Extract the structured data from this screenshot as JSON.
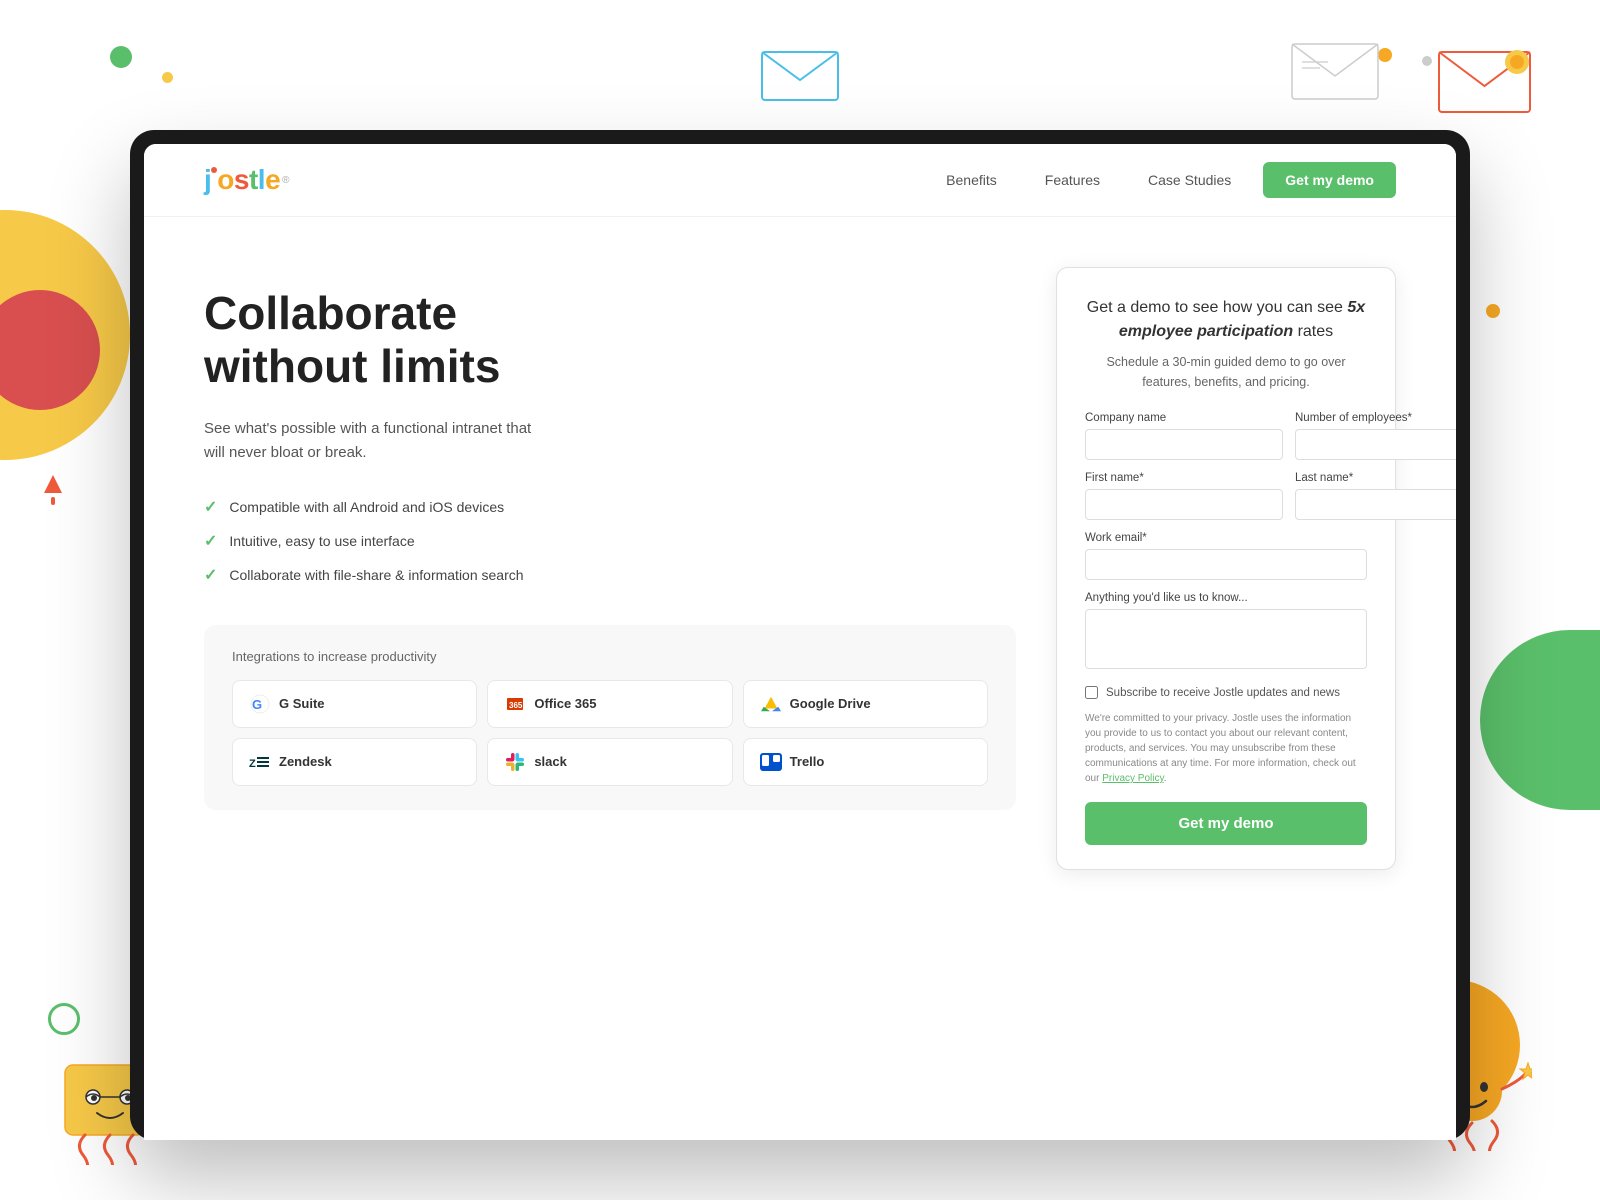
{
  "nav": {
    "logo": "jostle",
    "links": [
      "Benefits",
      "Features",
      "Case Studies"
    ],
    "cta_label": "Get my demo"
  },
  "hero": {
    "title_line1": "Collaborate",
    "title_line2": "without limits",
    "subtitle": "See what's possible with a functional intranet that will never bloat or break.",
    "features": [
      "Compatible with all Android and iOS devices",
      "Intuitive, easy to use interface",
      "Collaborate with file-share & information search"
    ]
  },
  "integrations": {
    "title": "Integrations to increase productivity",
    "items": [
      {
        "name": "G Suite",
        "icon": "G"
      },
      {
        "name": "Office 365",
        "icon": "O365"
      },
      {
        "name": "Google Drive",
        "icon": "GD"
      },
      {
        "name": "Zendesk",
        "icon": "ZD"
      },
      {
        "name": "slack",
        "icon": "SL"
      },
      {
        "name": "Trello",
        "icon": "TR"
      }
    ]
  },
  "demo_form": {
    "title_start": "Get a demo to see how you can see ",
    "title_emphasis": "5x employee participation",
    "title_end": " rates",
    "subtitle": "Schedule a 30-min guided demo to go over features, benefits, and pricing.",
    "fields": {
      "company_name": "Company name",
      "num_employees": "Number of employees*",
      "first_name": "First name*",
      "last_name": "Last name*",
      "work_email": "Work email*",
      "anything": "Anything you'd like us to know..."
    },
    "checkbox_label": "Subscribe to receive Jostle updates and news",
    "privacy_text": "We're committed to your privacy. Jostle uses the information you provide to us to contact you about our relevant content, products, and services. You may unsubscribe from these communications at any time. For more information, check out our",
    "privacy_link": "Privacy Policy",
    "submit_label": "Get my demo"
  },
  "colors": {
    "green": "#5ABF6A",
    "yellow": "#F7C948",
    "orange": "#F7A823",
    "red": "#EF5A3A",
    "blue": "#4ABEEA",
    "dark_red": "#D94F4F"
  }
}
